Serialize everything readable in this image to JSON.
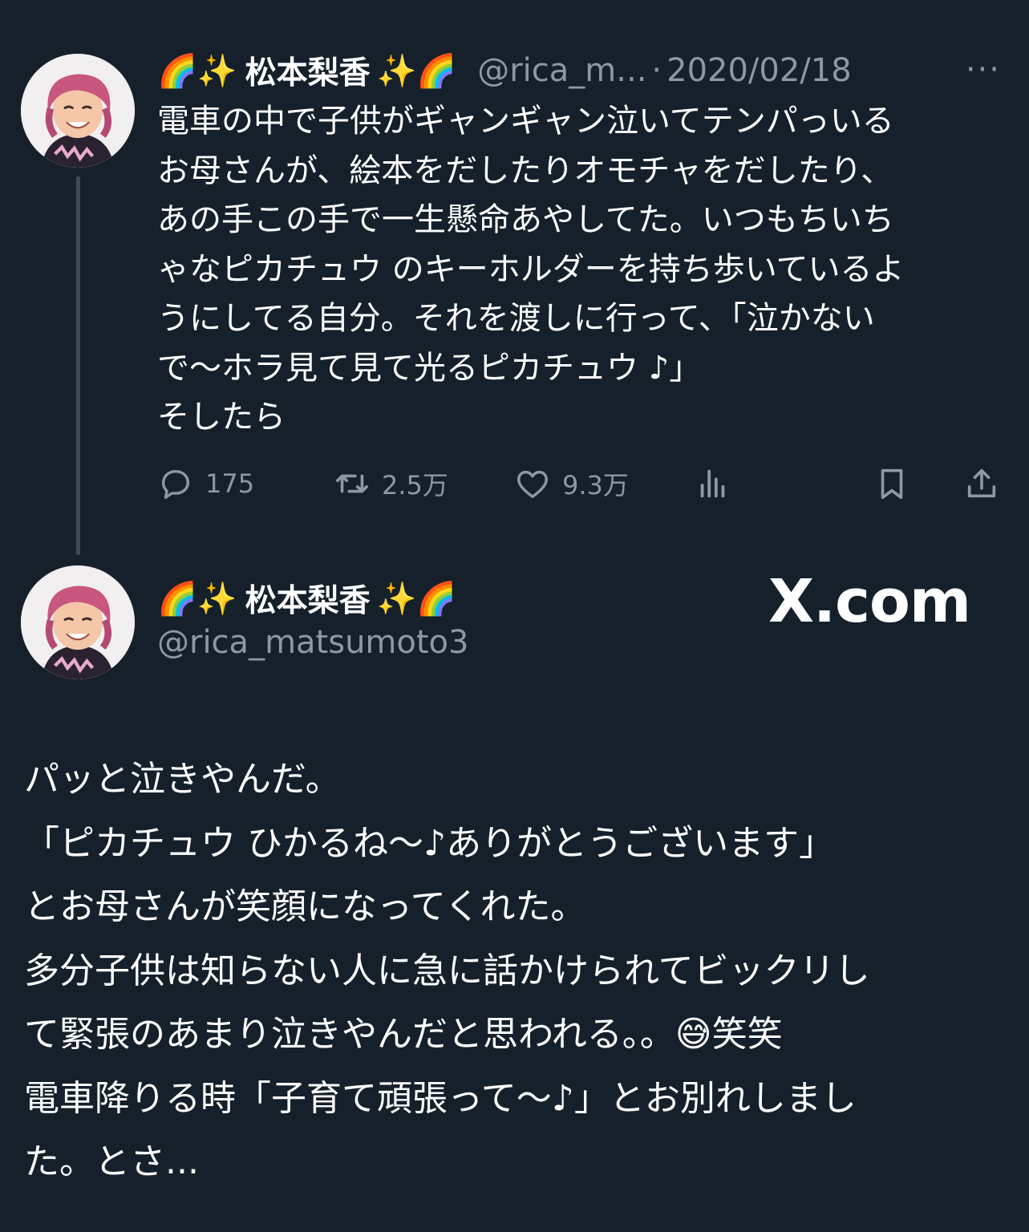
{
  "colors": {
    "background": "#15202b",
    "text": "#ffffff",
    "secondary": "#8b98a5",
    "thread_line": "#3e4a55"
  },
  "tweet1": {
    "emoji_left": "🌈✨",
    "display_name": "松本梨香",
    "emoji_right": "✨🌈",
    "handle": "@rica_m...",
    "separator": "·",
    "date": "2020/02/18",
    "more": "···",
    "text": "電車の中で子供がギャンギャン泣いてテンパっいる\nお母さんが、絵本をだしたりオモチャをだしたり、\nあの手この手で一生懸命あやしてた。いつもちいち\nゃなピカチュウ のキーホルダーを持ち歩いているよ\nうにしてる自分。それを渡しに行って、「泣かない\nで〜ホラ見て見て光るピカチュウ ♪」\nそしたら",
    "actions": {
      "replies": "175",
      "retweets": "2.5万",
      "likes": "9.3万"
    },
    "icons": [
      "reply-icon",
      "retweet-icon",
      "like-icon",
      "views-icon",
      "bookmark-icon",
      "share-icon"
    ]
  },
  "tweet2": {
    "emoji_left": "🌈✨",
    "display_name": "松本梨香",
    "emoji_right": "✨🌈",
    "handle": "@rica_matsumoto3",
    "text": "パッと泣きやんだ。\n「ピカチュウ ひかるね〜♪ありがとうございます」\nとお母さんが笑顔になってくれた。\n多分子供は知らない人に急に話かけられてビックリし\nて緊張のあまり泣きやんだと思われる。。😅笑笑\n電車降りる時「子育て頑張って〜♪」とお別れしまし\nた。とさ..."
  },
  "watermark": "X.com"
}
